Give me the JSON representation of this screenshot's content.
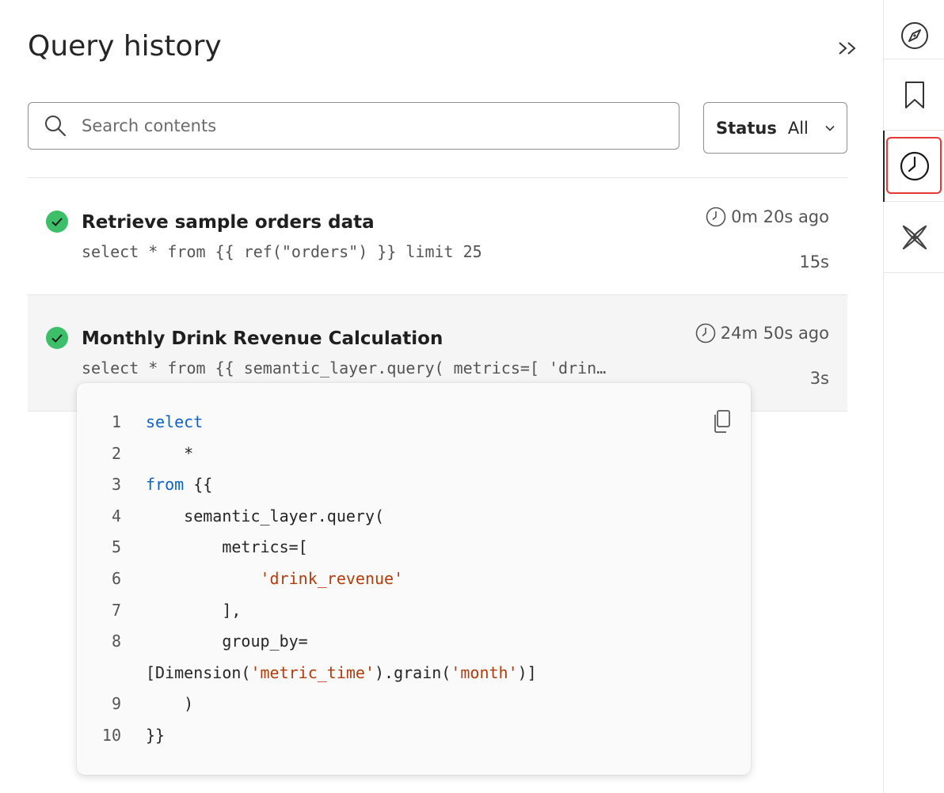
{
  "header": {
    "title": "Query history",
    "collapse_icon": "double-chevron-right-icon"
  },
  "search": {
    "placeholder": "Search contents",
    "value": ""
  },
  "status_filter": {
    "label": "Status",
    "value": "All"
  },
  "queries": [
    {
      "title": "Retrieve sample orders data",
      "sql": "select * from {{ ref(\"orders\") }} limit 25",
      "time_ago": "0m 20s ago",
      "duration": "15s",
      "status": "success"
    },
    {
      "title": "Monthly Drink Revenue Calculation",
      "sql": "select * from {{ semantic_layer.query( metrics=[ 'drin…",
      "time_ago": "24m 50s ago",
      "duration": "3s",
      "status": "success"
    }
  ],
  "code_popover": {
    "lines": [
      {
        "n": "1",
        "parts": [
          {
            "t": "select",
            "c": "kw"
          }
        ]
      },
      {
        "n": "2",
        "parts": [
          {
            "t": "    *",
            "c": ""
          }
        ]
      },
      {
        "n": "3",
        "parts": [
          {
            "t": "from",
            "c": "kw"
          },
          {
            "t": " {{",
            "c": ""
          }
        ]
      },
      {
        "n": "4",
        "parts": [
          {
            "t": "    semantic_layer.query(",
            "c": ""
          }
        ]
      },
      {
        "n": "5",
        "parts": [
          {
            "t": "        metrics=[",
            "c": ""
          }
        ]
      },
      {
        "n": "6",
        "parts": [
          {
            "t": "            ",
            "c": ""
          },
          {
            "t": "'drink_revenue'",
            "c": "str"
          }
        ]
      },
      {
        "n": "7",
        "parts": [
          {
            "t": "        ],",
            "c": ""
          }
        ]
      },
      {
        "n": "8",
        "parts": [
          {
            "t": "        group_by=",
            "c": ""
          }
        ]
      },
      {
        "n": "",
        "parts": [
          {
            "t": "[Dimension(",
            "c": ""
          },
          {
            "t": "'metric_time'",
            "c": "str"
          },
          {
            "t": ").grain(",
            "c": ""
          },
          {
            "t": "'month'",
            "c": "str"
          },
          {
            "t": ")]",
            "c": ""
          }
        ]
      },
      {
        "n": "9",
        "parts": [
          {
            "t": "    )",
            "c": ""
          }
        ]
      },
      {
        "n": "10",
        "parts": [
          {
            "t": "}}",
            "c": ""
          }
        ]
      }
    ]
  },
  "rail": {
    "items": [
      "compass-icon",
      "bookmark-icon",
      "clock-icon",
      "sparkle-x-icon"
    ],
    "active": "clock-icon"
  },
  "colors": {
    "success": "#3dbf6a",
    "keyword": "#0f62c8",
    "string": "#b23c0a",
    "focus_ring": "#e53935"
  }
}
